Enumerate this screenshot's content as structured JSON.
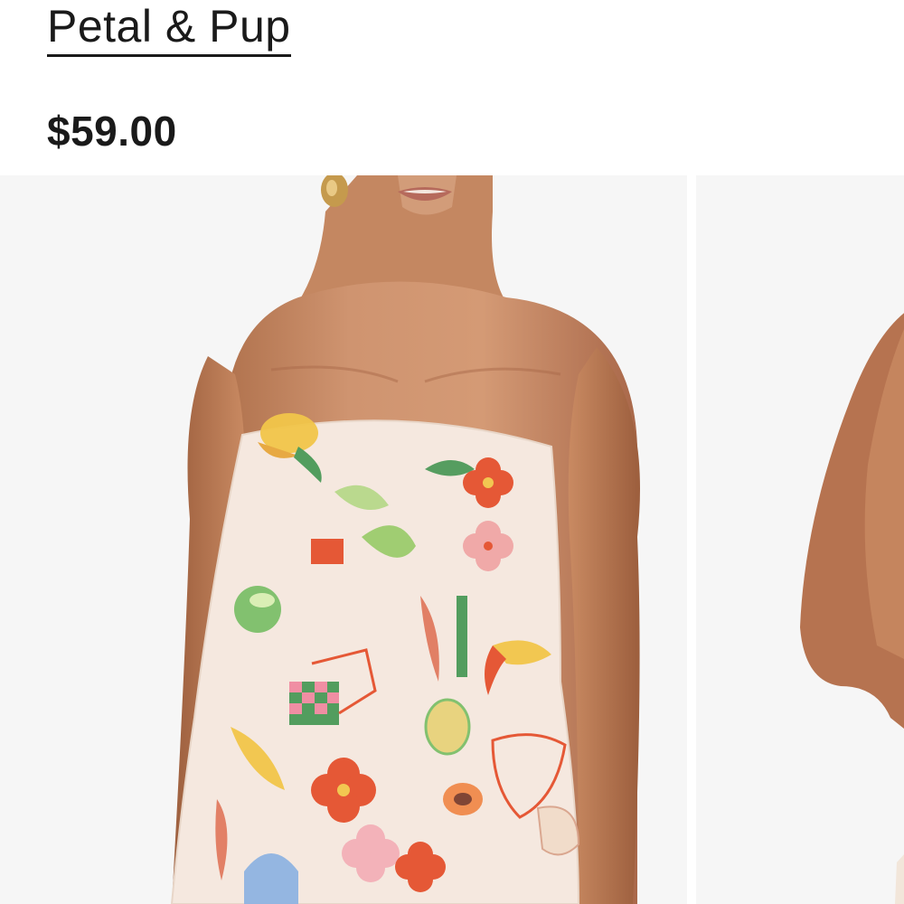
{
  "product": {
    "brand": "Petal & Pup",
    "price": "$59.00"
  },
  "gallery": {
    "images": [
      {
        "alt": "Model wearing strapless tropical print mini dress, front view"
      },
      {
        "alt": "Model wearing strapless tropical print mini dress, back view"
      }
    ]
  },
  "colors": {
    "text": "#1a1a1a",
    "photo_bg": "#f6f6f6",
    "skin": "#c98a62",
    "fabric": "#f5e8df"
  }
}
